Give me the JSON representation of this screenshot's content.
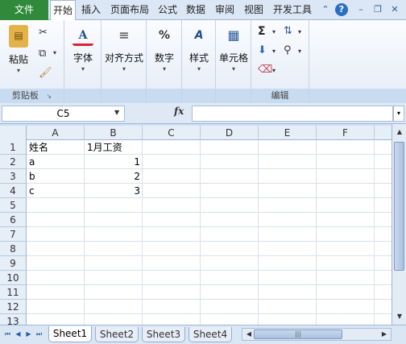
{
  "ribbon_tabs": {
    "file": "文件",
    "tabs": [
      "开始",
      "插入",
      "页面布局",
      "公式",
      "数据",
      "审阅",
      "视图",
      "开发工具"
    ],
    "active": "开始"
  },
  "ribbon": {
    "clipboard": {
      "paste": "粘贴",
      "label": "剪贴板"
    },
    "font": {
      "label": "字体"
    },
    "alignment": {
      "label": "对齐方式"
    },
    "number": {
      "label": "数字"
    },
    "styles": {
      "label": "样式"
    },
    "cells": {
      "label": "单元格"
    },
    "editing": {
      "label": "编辑",
      "sum_symbol": "Σ"
    }
  },
  "formula_bar": {
    "name_box": "C5",
    "fx": "fx",
    "formula": ""
  },
  "sheet": {
    "columns": [
      "A",
      "B",
      "C",
      "D",
      "E",
      "F"
    ],
    "rows": [
      "1",
      "2",
      "3",
      "4",
      "5",
      "6",
      "7",
      "8",
      "9",
      "10",
      "11",
      "12",
      "13"
    ],
    "cells": {
      "A1": "姓名",
      "B1": "1月工资",
      "A2": "a",
      "B2": "1",
      "A3": "b",
      "B3": "2",
      "A4": "c",
      "B4": "3"
    }
  },
  "sheet_tabs": {
    "tabs": [
      "Sheet1",
      "Sheet2",
      "Sheet3",
      "Sheet4"
    ],
    "active": "Sheet1"
  },
  "colors": {
    "file_tab": "#2f8a3b",
    "accent": "#2b5c9a"
  },
  "icons": [
    "paste-icon",
    "cut-icon",
    "copy-icon",
    "format-painter-icon",
    "font-icon",
    "align-icon",
    "percent-icon",
    "styles-icon",
    "cells-icon",
    "sum-icon",
    "sort-filter-icon",
    "find-icon",
    "fill-icon",
    "clear-icon",
    "help-icon"
  ]
}
